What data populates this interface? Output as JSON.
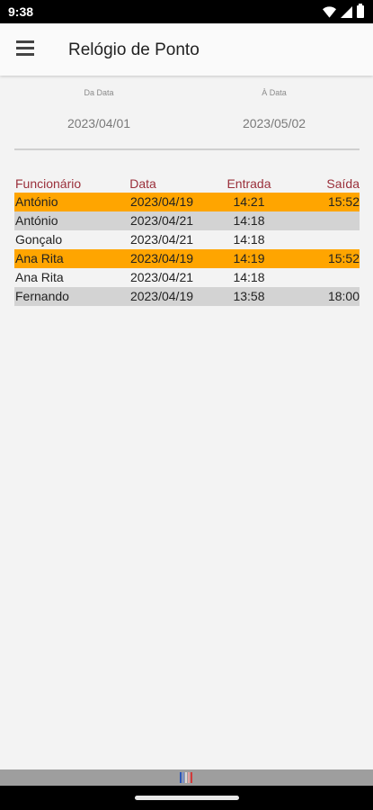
{
  "status_bar": {
    "time": "9:38"
  },
  "app_bar": {
    "title": "Relógio de Ponto"
  },
  "filters": {
    "from_label": "Da Data",
    "from_value": "2023/04/01",
    "to_label": "À Data",
    "to_value": "2023/05/02"
  },
  "table": {
    "headers": {
      "name": "Funcionário",
      "date": "Data",
      "in": "Entrada",
      "out": "Saída"
    },
    "rows": [
      {
        "name": "António",
        "date": "2023/04/19",
        "in": "14:21",
        "out": "15:52",
        "style": "orange"
      },
      {
        "name": "António",
        "date": "2023/04/21",
        "in": "14:18",
        "out": "",
        "style": "gray"
      },
      {
        "name": "Gonçalo",
        "date": "2023/04/21",
        "in": "14:18",
        "out": "",
        "style": "plain"
      },
      {
        "name": "Ana Rita",
        "date": "2023/04/19",
        "in": "14:19",
        "out": "15:52",
        "style": "orange"
      },
      {
        "name": "Ana Rita",
        "date": "2023/04/21",
        "in": "14:18",
        "out": "",
        "style": "plain"
      },
      {
        "name": "Fernando",
        "date": "2023/04/19",
        "in": "13:58",
        "out": "18:00",
        "style": "gray"
      }
    ]
  },
  "colors": {
    "header_text": "#9a2f3a",
    "highlight": "#ffa500",
    "alt_row": "#d3d3d3"
  },
  "icons": [
    "menu-icon",
    "wifi-icon",
    "signal-icon",
    "battery-icon",
    "flag-icon"
  ]
}
